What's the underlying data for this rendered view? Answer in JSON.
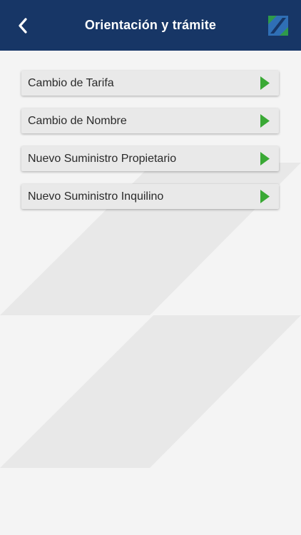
{
  "header": {
    "title": "Orientación y trámite",
    "back_icon": "chevron-left-icon",
    "logo_icon": "brand-logo-icon"
  },
  "menu": {
    "items": [
      {
        "label": "Cambio de Tarifa",
        "icon": "play-arrow-icon"
      },
      {
        "label": "Cambio de Nombre",
        "icon": "play-arrow-icon"
      },
      {
        "label": "Nuevo Suministro Propietario",
        "icon": "play-arrow-icon"
      },
      {
        "label": "Nuevo Suministro Inquilino",
        "icon": "play-arrow-icon"
      }
    ]
  },
  "colors": {
    "header_background": "#173666",
    "page_background": "#f4f4f4",
    "menu_item_background": "#e9e9e9",
    "arrow_green": "#3aa935",
    "logo_blue": "#2f6fb5",
    "logo_green": "#2e9a4a"
  }
}
